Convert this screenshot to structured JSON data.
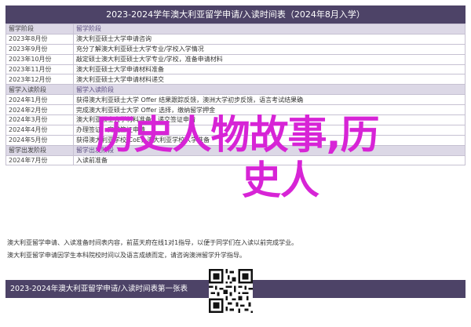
{
  "title": "2023-2024学年澳大利亚留学申请/入读时间表（2024年8月入学）",
  "sections": [
    {
      "label": "留学阶段",
      "rows": [
        {
          "date": "2023年8月份",
          "event": "澳大利亚硕士大学申请咨询"
        },
        {
          "date": "2023年9月份",
          "event": "充分了解澳大利亚硕士大学专业/学校入学情况"
        },
        {
          "date": "2023年10月份",
          "event": "敲定硕士澳大利亚硕士大学专业/学校，准备申请材料"
        },
        {
          "date": "2023年11月份",
          "event": "澳大利亚硕士大学申请材料准备"
        },
        {
          "date": "2023年12月份",
          "event": "澳大利亚硕士大学申请材料递交"
        }
      ]
    },
    {
      "label": "留学入读阶段",
      "rows": [
        {
          "date": "2024年1月份",
          "event": "获得澳大利亚硕士大学 Offer 结果跟踪反馈，澳洲大学初步反馈，语言考试结果确"
        },
        {
          "date": "2024年2月份",
          "event": "完成澳大利亚硕士大学 Offer 选择，缴纳留学押金"
        },
        {
          "date": "2024年3月份",
          "event": "澳大利亚硕士大学材料准备，递交签证申请"
        },
        {
          "date": "2024年4月份",
          "event": "办理签证，完成签证申请"
        },
        {
          "date": "2024年5月份",
          "event": "获得澳大利亚学校 CoE，澳大利亚学校入学准备"
        }
      ]
    },
    {
      "label": "留学出发阶段",
      "rows": [
        {
          "date": "2024年7月份",
          "event": "入读前准备"
        }
      ]
    }
  ],
  "overlay": {
    "line1": "历史人物故事,历",
    "line2": "史人"
  },
  "notes": [
    "澳大利亚留学申请、入读准备时间表内容，前蓝天府在线1对1指导，以便于同学们在入读以前完成学业。",
    "澳大利亚留学申请因学生本科院校时间以及语言成绩而定，请咨询澳洲留学升学指导。"
  ],
  "footer": "2023-2024年澳大利亚留学申请/入读时间表第一张表"
}
